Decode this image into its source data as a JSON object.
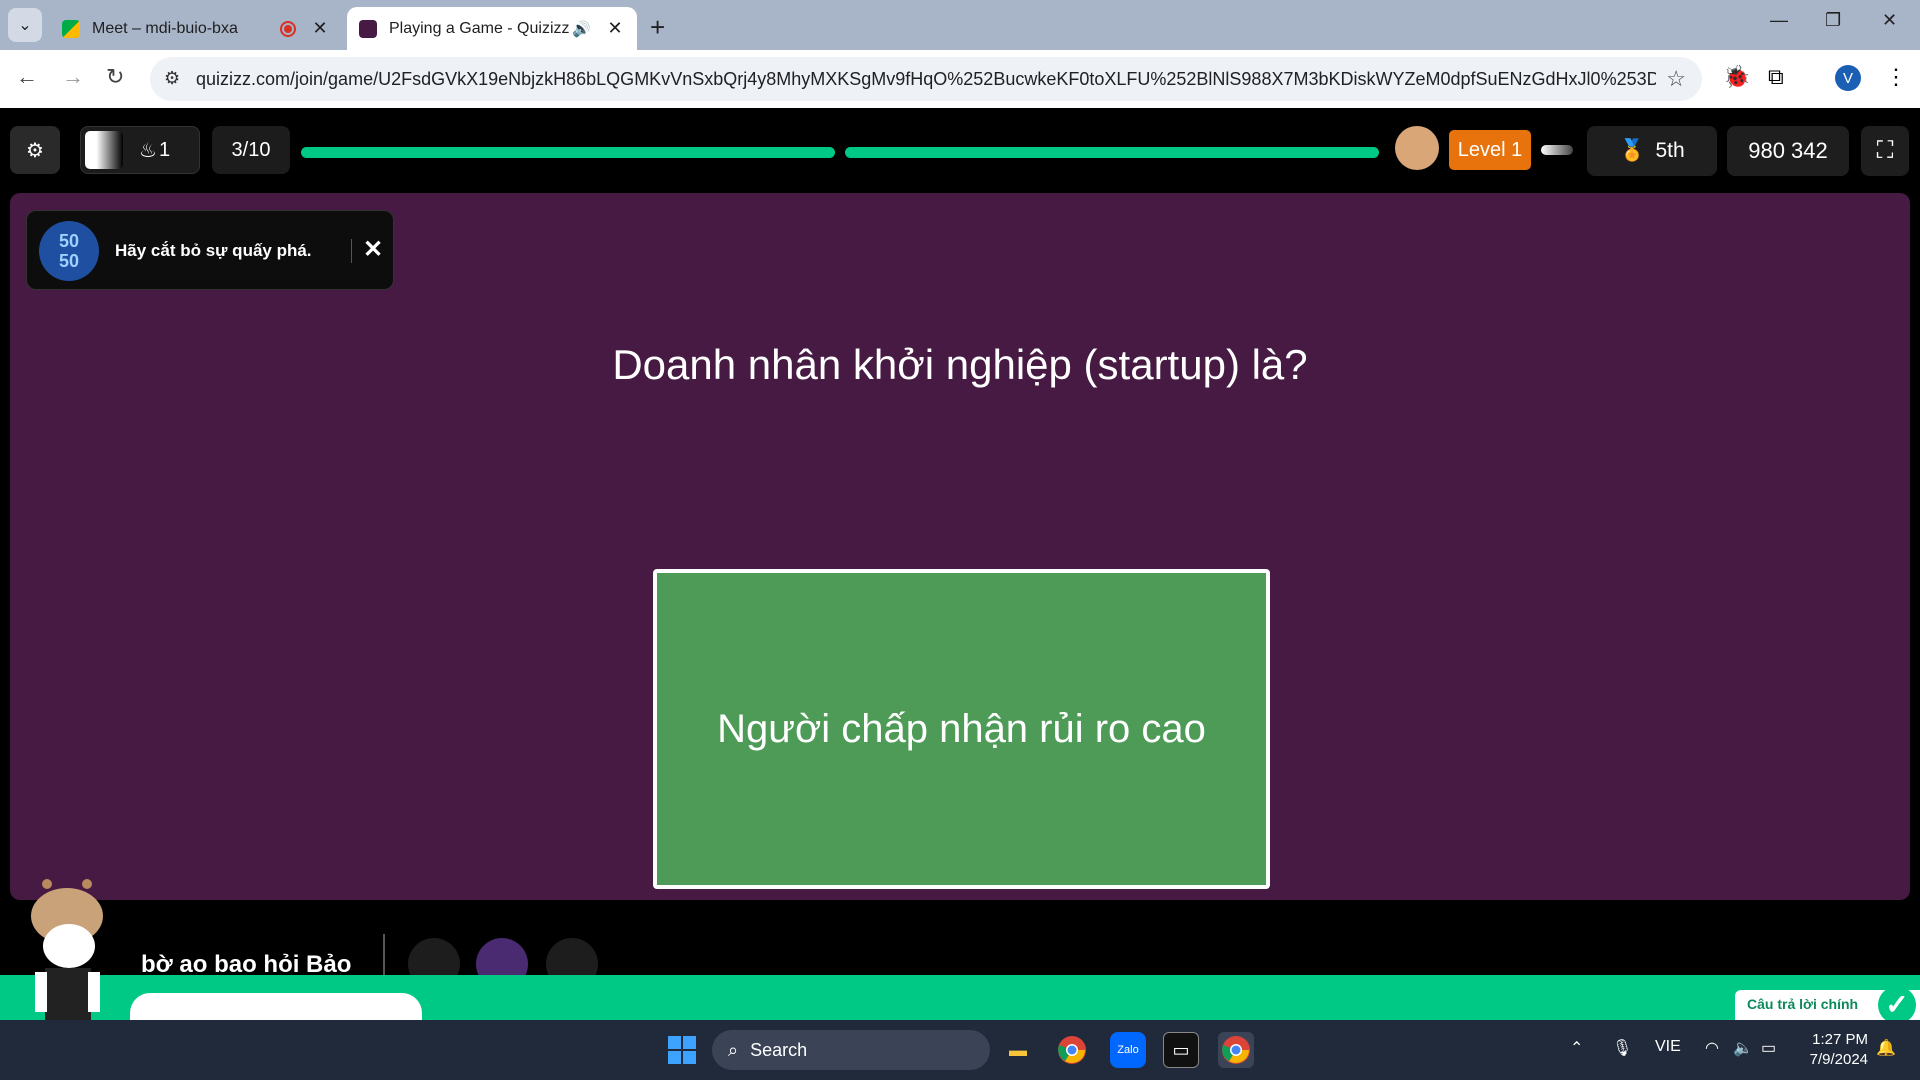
{
  "browser": {
    "tabs": [
      {
        "title": "Meet – mdi-buio-bxa"
      },
      {
        "title": "Playing a Game - Quizizz"
      }
    ],
    "url": "quizizz.com/join/game/U2FsdGVkX19eNbjzkH86bLQGMKvVnSxbQrj4y8MhyMXKSgMv9fHqO%252BucwkeKF0toXLFU%252BlNlS988X7M3bKDiskWYZeM0dpfSuENzGdHxJl0%253D?gameTy...",
    "profile_initial": "V"
  },
  "game": {
    "streak_count": "1",
    "question_counter": "3/10",
    "level": "Level 1",
    "rank": "5th",
    "score": "980 342",
    "toast_message": "Hãy cắt bỏ sự quấy phá.",
    "toast_icon": "50\n50",
    "question": "Doanh nhân khởi nghiệp (startup) là?",
    "answer": "Người chấp nhận rủi ro cao",
    "player_name": "bờ ao bao hỏi Bảo",
    "feedback": "Câu trả lời chính",
    "colors": {
      "stage": "#461a42",
      "answer": "#4e9b57",
      "progress": "#00c985",
      "level": "#e8730c"
    }
  },
  "taskbar": {
    "search_label": "Search",
    "language": "VIE",
    "time": "1:27 PM",
    "date": "7/9/2024"
  }
}
